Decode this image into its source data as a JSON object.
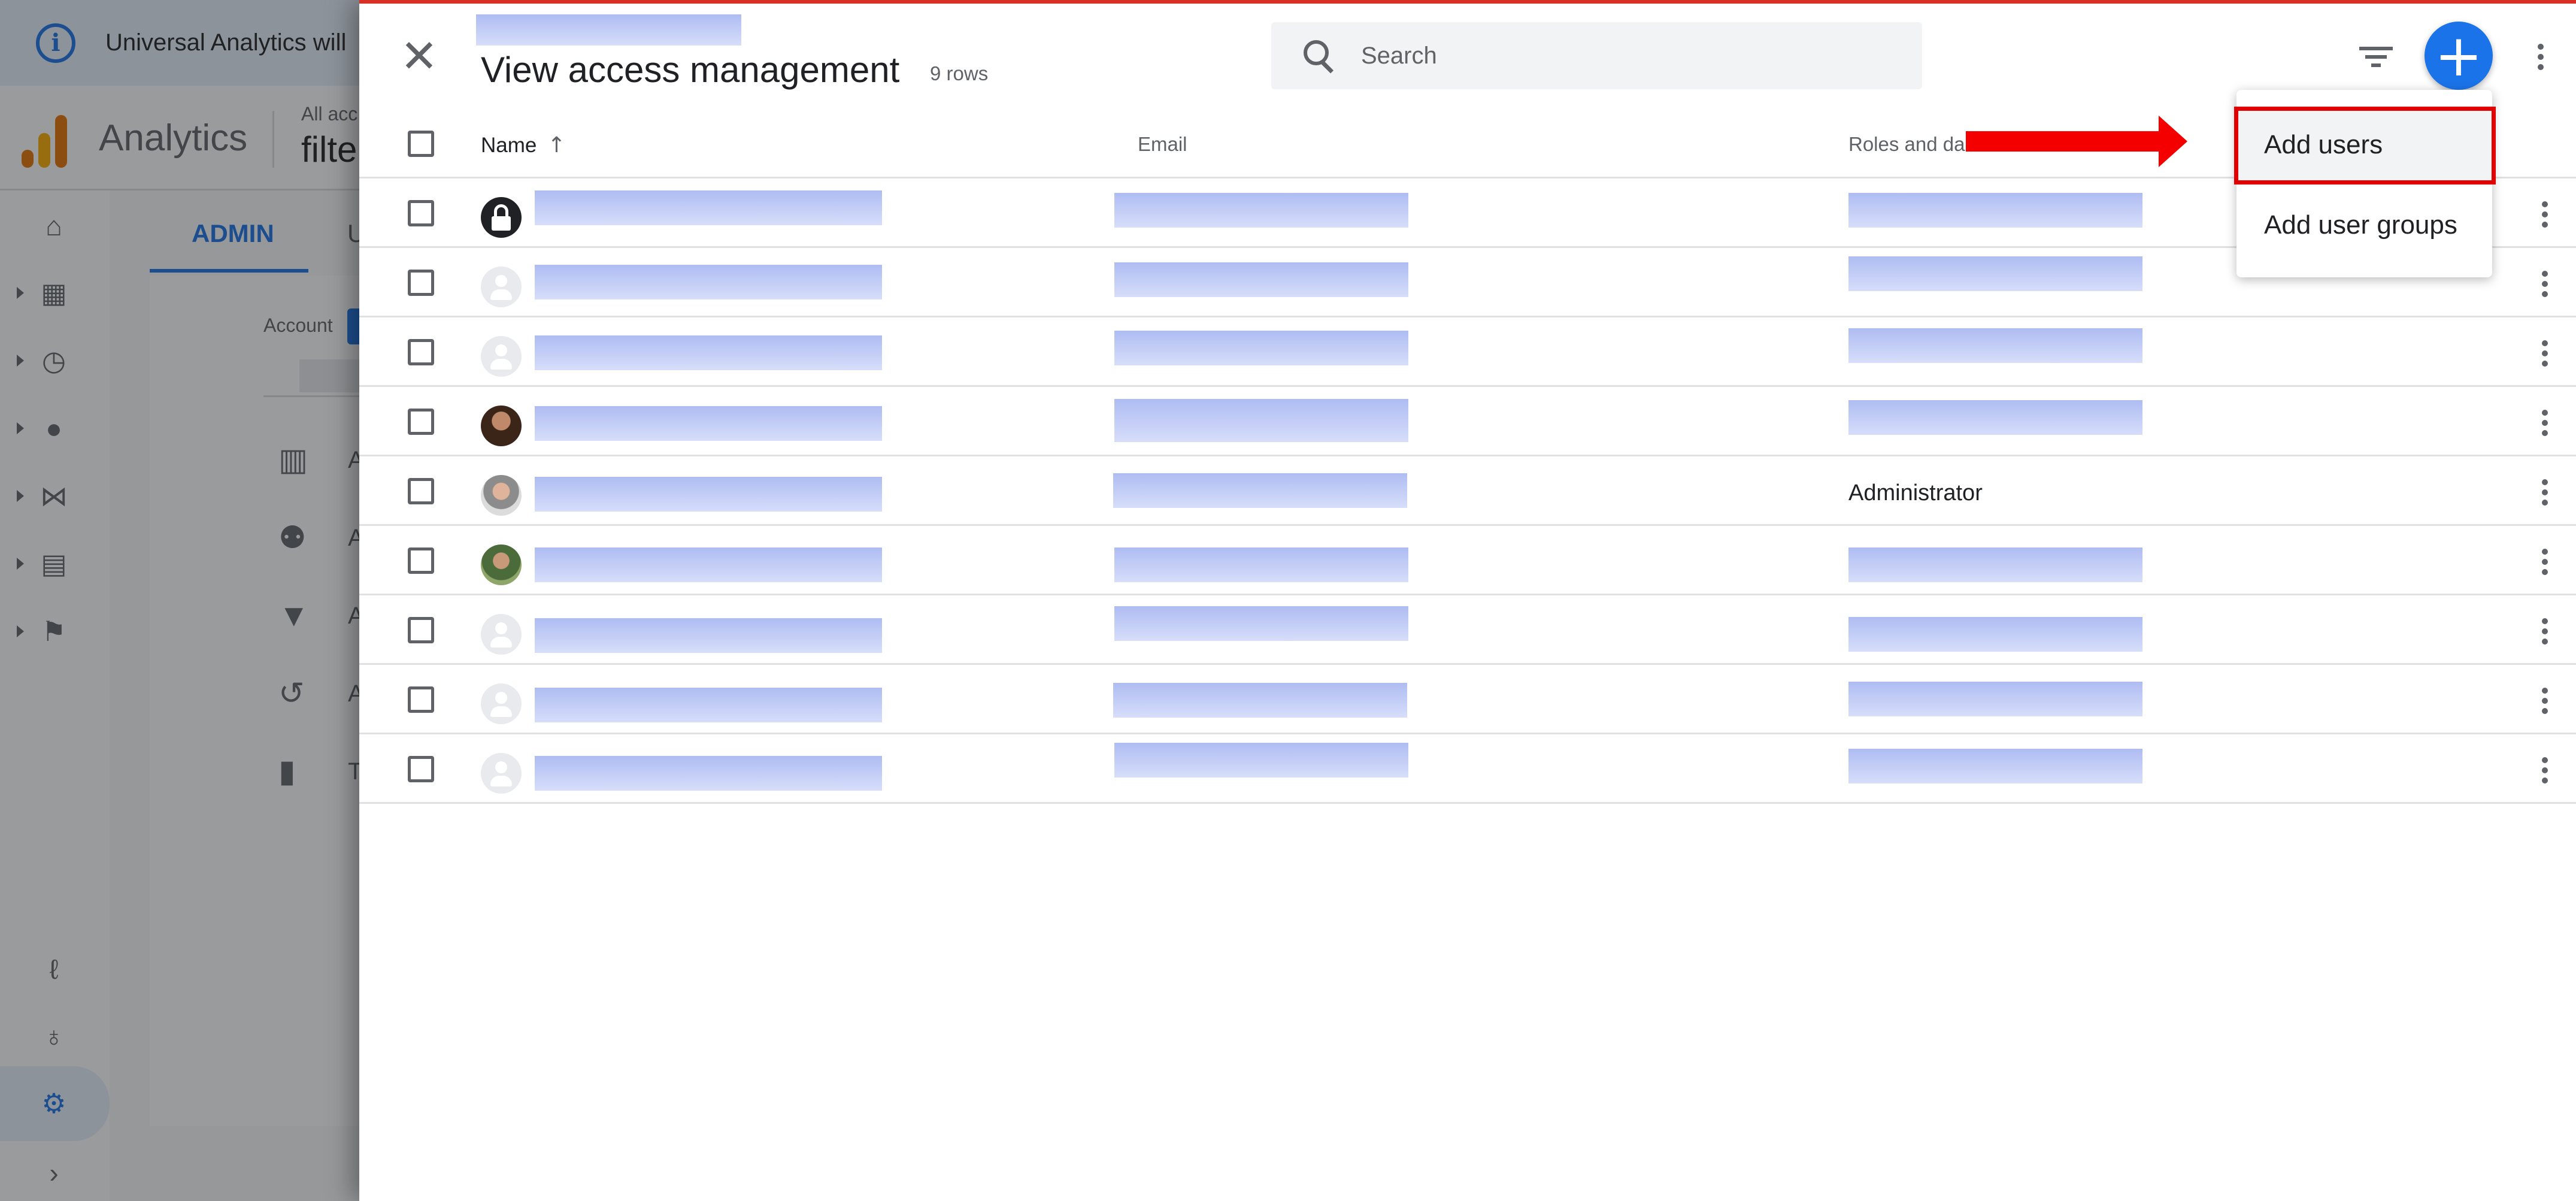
{
  "background": {
    "banner_text": "Universal Analytics will",
    "app_title": "Analytics",
    "breadcrumb_top": "All acc",
    "breadcrumb_main": "filte",
    "tabs": [
      "ADMIN",
      "U"
    ],
    "account_label": "Account",
    "admin_items": [
      {
        "icon": "building-icon",
        "label": "Ac"
      },
      {
        "icon": "people-icon",
        "label": "Ac"
      },
      {
        "icon": "filter-icon",
        "label": "All"
      },
      {
        "icon": "history-icon",
        "label": "Ac"
      },
      {
        "icon": "trash-icon",
        "label": "Tra"
      }
    ],
    "rail_icons": [
      "home-icon",
      "dashboard-icon",
      "clock-icon",
      "person-icon",
      "acquisition-icon",
      "display-icon",
      "flag-icon",
      "path-icon",
      "lightbulb-icon",
      "gear-icon",
      "expand-icon"
    ]
  },
  "drawer": {
    "title": "View access management",
    "row_count": "9 rows",
    "search_placeholder": "Search"
  },
  "table": {
    "columns": {
      "name": "Name",
      "email": "Email",
      "roles": "Roles and da"
    },
    "sort": "ascending",
    "rows": [
      {
        "avatar": "lock",
        "role": ""
      },
      {
        "avatar": "generic",
        "role": ""
      },
      {
        "avatar": "generic",
        "role": ""
      },
      {
        "avatar": "photo1",
        "role": ""
      },
      {
        "avatar": "photo2",
        "role": "Administrator"
      },
      {
        "avatar": "photo3",
        "role": ""
      },
      {
        "avatar": "generic",
        "role": ""
      },
      {
        "avatar": "generic",
        "role": ""
      },
      {
        "avatar": "generic",
        "role": ""
      }
    ]
  },
  "menu": {
    "items": [
      "Add users",
      "Add user groups"
    ],
    "highlighted": "Add users"
  },
  "colors": {
    "accent": "#1a73e8",
    "annotation": "#f40000",
    "redaction": "#aebcf2"
  }
}
